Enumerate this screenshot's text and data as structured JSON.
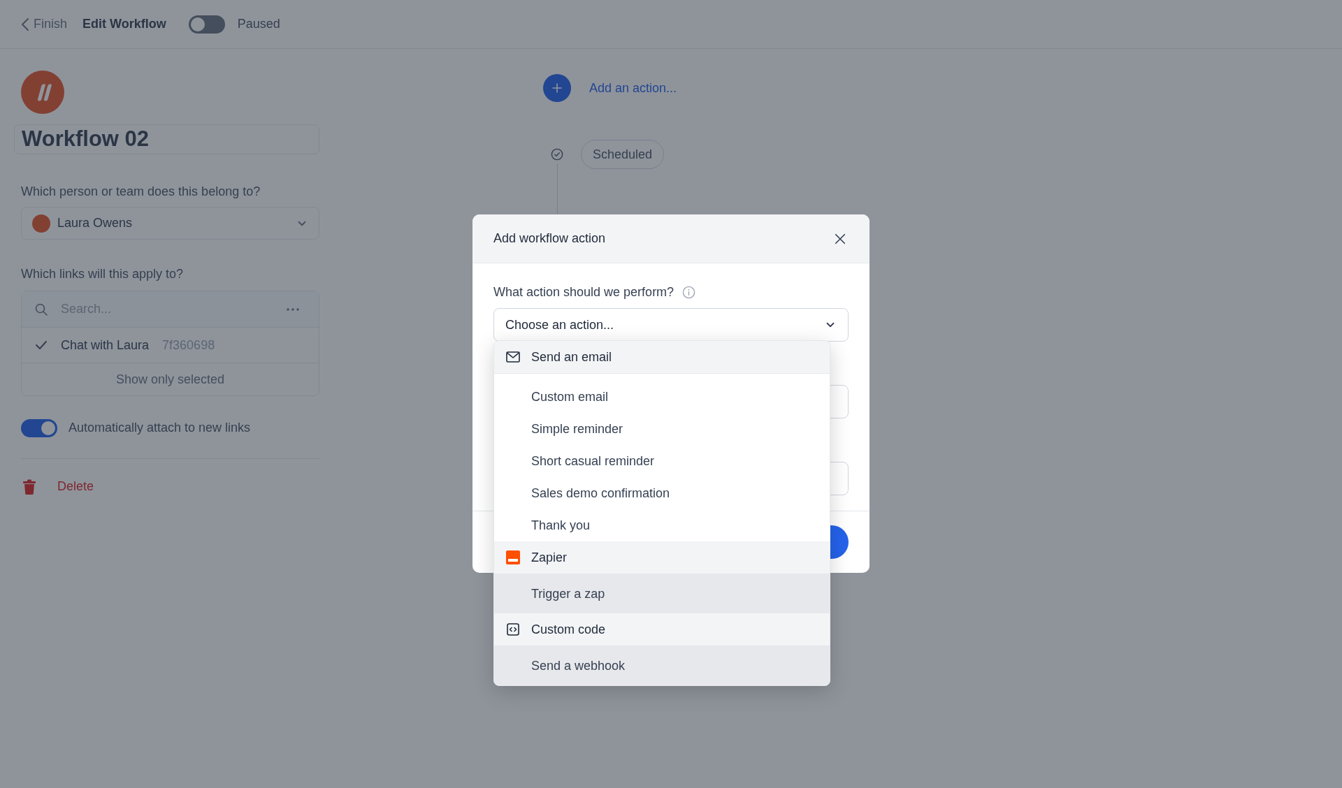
{
  "top_bar": {
    "back_label": "Finish",
    "title": "Edit Workflow",
    "toggle": {
      "label": "Paused",
      "on": false
    }
  },
  "sidebar": {
    "workflow_name": "Workflow 02",
    "owner_label": "Which person or team does this belong to?",
    "owner": "Laura Owens",
    "links_label": "Which links will this apply to?",
    "links_search": {
      "placeholder": "Search..."
    },
    "links": [
      {
        "name": "Chat with Laura",
        "code": "7f360698",
        "checked": true
      }
    ],
    "show_selected": "Show only selected",
    "auto_attach": {
      "label": "Automatically attach to new links",
      "on": true
    },
    "delete": "Delete"
  },
  "canvas": {
    "add_action": "Add an action...",
    "steps": [
      {
        "label": "Scheduled",
        "done": true
      }
    ]
  },
  "modal": {
    "title": "Add workflow action",
    "field_label": "What action should we perform?",
    "select": {
      "value": "Choose an action..."
    },
    "menu": [
      {
        "kind": "email-group",
        "label": "Send an email",
        "highlighted": false
      },
      {
        "kind": "option",
        "label": "Custom email",
        "highlighted": false
      },
      {
        "kind": "option",
        "label": "Simple reminder",
        "highlighted": false
      },
      {
        "kind": "option",
        "label": "Short casual reminder",
        "highlighted": false
      },
      {
        "kind": "option",
        "label": "Sales demo confirmation",
        "highlighted": false
      },
      {
        "kind": "option",
        "label": "Thank you",
        "highlighted": false
      },
      {
        "kind": "zapier-group",
        "label": "Zapier",
        "highlighted": false
      },
      {
        "kind": "option",
        "label": "Trigger a zap",
        "highlighted": true
      },
      {
        "kind": "code-group",
        "label": "Custom code",
        "highlighted": false
      },
      {
        "kind": "option",
        "label": "Send a webhook",
        "highlighted": true
      }
    ]
  }
}
